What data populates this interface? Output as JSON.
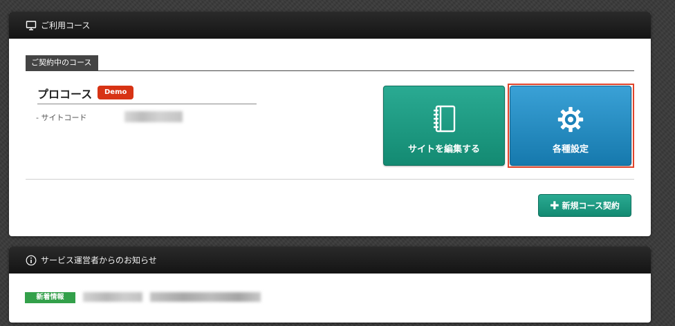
{
  "courses_panel": {
    "header_title": "ご利用コース",
    "header_icon": "monitor-icon",
    "section_tab": "ご契約中のコース",
    "course": {
      "name": "プロコース",
      "badge": "Demo",
      "site_code_label": "- サイトコード"
    },
    "buttons": {
      "edit_site": {
        "label": "サイトを編集する",
        "icon": "notebook-icon"
      },
      "settings": {
        "label": "各種設定",
        "icon": "gear-icon"
      },
      "new_course": {
        "label": "新規コース契約",
        "icon": "plus-icon"
      }
    }
  },
  "news_panel": {
    "header_title": "サービス運営者からのお知らせ",
    "header_icon": "info-icon",
    "items": [
      {
        "tag": "新着情報"
      }
    ]
  },
  "colors": {
    "teal": "#1f9a81",
    "blue": "#2289c1",
    "demo_red": "#d73314",
    "news_green": "#33a04a",
    "highlight": "#e0432a"
  }
}
